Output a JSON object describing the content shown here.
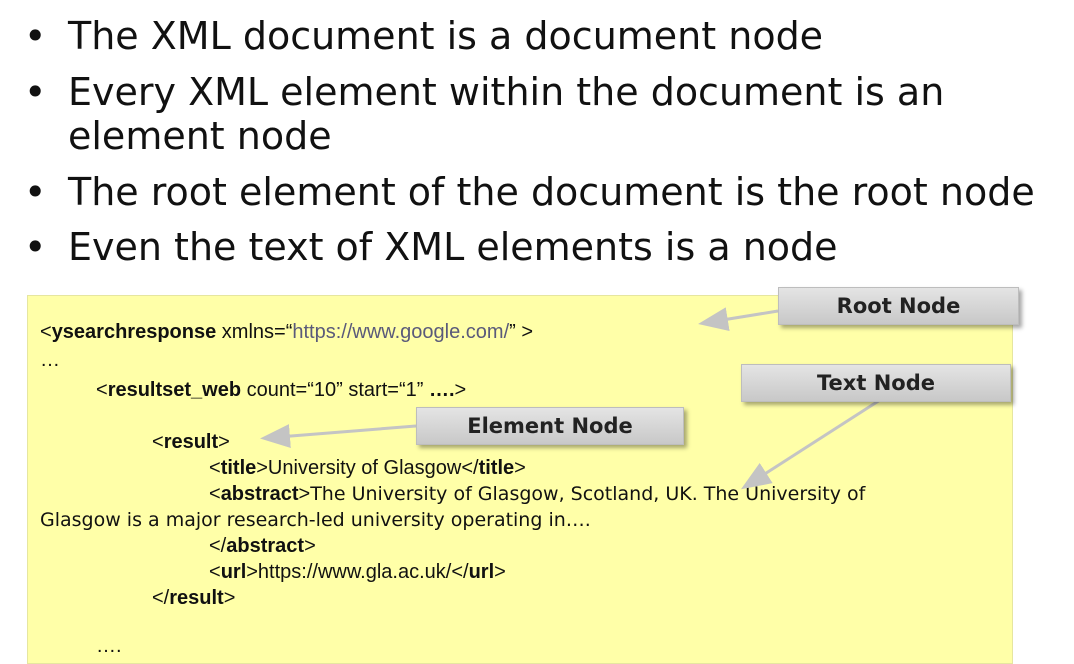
{
  "bullets": [
    {
      "marker": "•",
      "text": "The XML document is a document node"
    },
    {
      "marker": "•",
      "text": "Every XML element within the document is an element node"
    },
    {
      "marker": "•",
      "text": "The root element of the document is the root node"
    },
    {
      "marker": "•",
      "text": "Even the text of XML elements is a node"
    }
  ],
  "code": {
    "l1_open": "<",
    "l1_tag": "ysearchresponse",
    "l1_attr": " xmlns=“",
    "l1_url": "https://www.google.com/",
    "l1_close": "” >",
    "l2": "…",
    "l3_open": "<",
    "l3_tag": "resultset_web",
    "l3_attr": " count=“10” start=“1” ",
    "l3_dots": "….",
    "l3_close": ">",
    "l4_open": "<",
    "l4_tag": "result",
    "l4_close": ">",
    "l5_open": "<",
    "l5_tag": "title",
    "l5_mid": ">University of Glasgow</",
    "l5_tag2": "title",
    "l5_close": ">",
    "l6_open": "<",
    "l6_tag": "abstract",
    "l6_close": ">",
    "l6_text": "The University of Glasgow, Scotland, UK. The University of",
    "l7_text": "Glasgow is a major research-led university operating in….",
    "l8_open": "</",
    "l8_tag": "abstract",
    "l8_close": ">",
    "l9_open": "<",
    "l9_tag": "url",
    "l9_mid": ">https://www.gla.ac.uk/</",
    "l9_tag2": "url",
    "l9_close": ">",
    "l10_open": "</",
    "l10_tag": "result",
    "l10_close": ">",
    "l11": "…."
  },
  "labels": {
    "root": "Root Node",
    "text": "Text Node",
    "element": "Element Node"
  },
  "colors": {
    "box_background": "#ffffa8",
    "label_background": "#d6d6d6",
    "url": "#5a5a7a"
  }
}
